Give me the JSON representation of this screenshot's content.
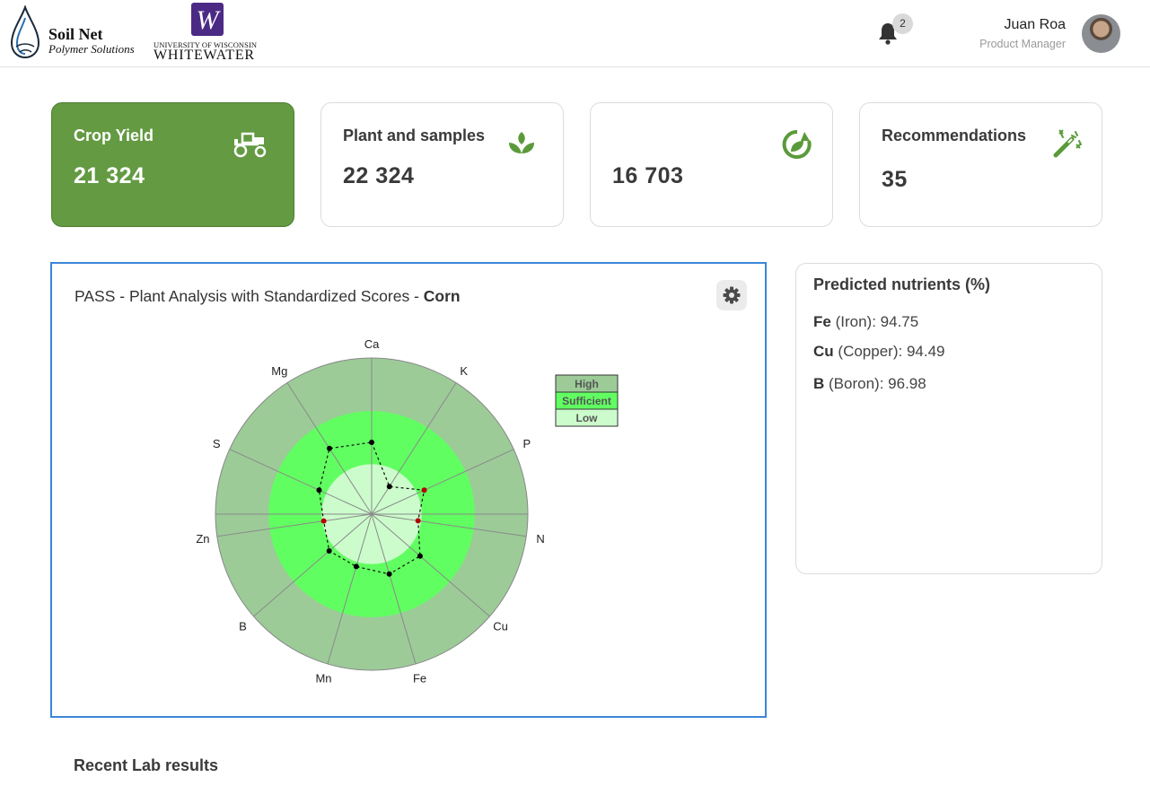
{
  "header": {
    "brand_line1": "Soil Net",
    "brand_line2": "Polymer Solutions",
    "partner_line1": "UNIVERSITY OF WISCONSIN",
    "partner_line2": "WHITEWATER",
    "partner_mark": "W",
    "notification_count": "2",
    "user_name": "Juan Roa",
    "user_role": "Product Manager"
  },
  "cards": [
    {
      "title": "Crop Yield",
      "value": "21 324",
      "icon": "tractor-icon",
      "active": true
    },
    {
      "title": "Plant and samples",
      "value": "22 324",
      "icon": "plant-icon",
      "active": false
    },
    {
      "title": "",
      "value": "16 703",
      "icon": "recycle-leaf-icon",
      "active": false
    },
    {
      "title": "Recommendations",
      "value": "35",
      "icon": "magic-wand-icon",
      "active": false
    }
  ],
  "chart_panel": {
    "title": "PASS - Plant Analysis with Standardized Scores  - ",
    "crop": "Corn"
  },
  "chart_data": {
    "type": "radar",
    "categories": [
      "Ca",
      "K",
      "P",
      "N",
      "Cu",
      "Fe",
      "Mn",
      "B",
      "Zn",
      "S",
      "Mg"
    ],
    "band_labels": [
      "High",
      "Sufficient",
      "Low"
    ],
    "band_colors": {
      "High": "#9ccb98",
      "Sufficient": "#61fe61",
      "Low": "#ccfccc"
    },
    "band_limits": [
      0.32,
      0.66,
      1.0
    ],
    "values": [
      0.46,
      0.21,
      0.37,
      0.3,
      0.41,
      0.4,
      0.35,
      0.36,
      0.31,
      0.37,
      0.5
    ],
    "flagged": [
      "P",
      "N",
      "Zn"
    ],
    "point_colors": {
      "normal": "#000000",
      "flagged": "#b30000"
    },
    "grid": true,
    "legend_position": "top-right"
  },
  "nutrients": {
    "title": "Predicted nutrients  (%)",
    "items": [
      {
        "symbol": "Fe",
        "name": "(Iron)",
        "value": "94.75"
      },
      {
        "symbol": "Cu",
        "name": "(Copper)",
        "value": "94.49"
      },
      {
        "symbol": "B",
        "name": "(Boron)",
        "value": "96.98"
      }
    ]
  },
  "recent": {
    "title": "Recent Lab results"
  },
  "colors": {
    "accent": "#639a42",
    "selection_border": "#3a86d8"
  }
}
